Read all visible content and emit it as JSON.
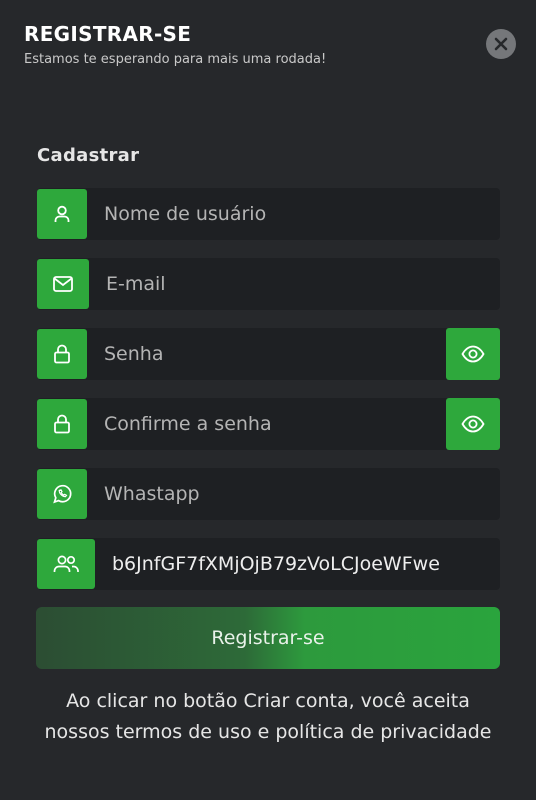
{
  "header": {
    "title": "REGISTRAR-SE",
    "subtitle": "Estamos te esperando para mais uma rodada!"
  },
  "form": {
    "section_title": "Cadastrar",
    "username_placeholder": "Nome de usuário",
    "email_placeholder": "E-mail",
    "password_placeholder": "Senha",
    "confirm_password_placeholder": "Confirme a senha",
    "whatsapp_placeholder": "Whastapp",
    "referral_value": "b6JnfGF7fXMjOjB79zVoLCJoeWFwe",
    "submit_label": "Registrar-se",
    "terms_text": "Ao clicar no botão Criar conta, você aceita nossos termos de uso e política de privacidade"
  },
  "colors": {
    "accent": "#2ea83c",
    "background": "#26282b",
    "field_bg": "#1e2023"
  },
  "icons": [
    "close-icon",
    "user-icon",
    "mail-icon",
    "lock-icon",
    "eye-icon",
    "whatsapp-icon",
    "users-icon"
  ]
}
